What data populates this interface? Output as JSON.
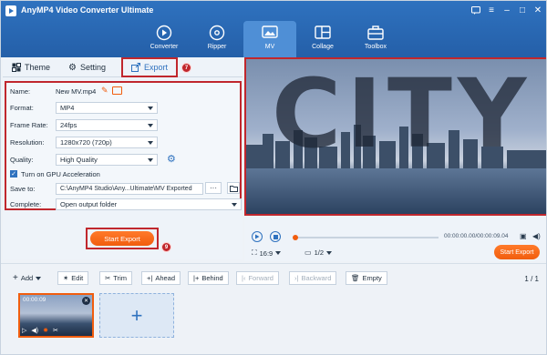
{
  "app": {
    "title": "AnyMP4 Video Converter Ultimate"
  },
  "nav": {
    "items": [
      {
        "label": "Converter",
        "icon": "converter-icon"
      },
      {
        "label": "Ripper",
        "icon": "disc-icon"
      },
      {
        "label": "MV",
        "icon": "mv-icon",
        "active": true
      },
      {
        "label": "Collage",
        "icon": "collage-icon"
      },
      {
        "label": "Toolbox",
        "icon": "toolbox-icon"
      }
    ]
  },
  "tabs": {
    "theme": "Theme",
    "setting": "Setting",
    "export": "Export",
    "export_badge": "7"
  },
  "export": {
    "name_label": "Name:",
    "name_value": "New MV.mp4",
    "format_label": "Format:",
    "format_value": "MP4",
    "frame_rate_label": "Frame Rate:",
    "frame_rate_value": "24fps",
    "resolution_label": "Resolution:",
    "resolution_value": "1280x720 (720p)",
    "quality_label": "Quality:",
    "quality_value": "High Quality",
    "gpu_label": "Turn on GPU Acceleration",
    "save_label": "Save to:",
    "save_value": "C:\\AnyMP4 Studio\\Any...Ultimate\\MV Exported",
    "browse_label": "···",
    "complete_label": "Complete:",
    "complete_value": "Open output folder",
    "settings_badge": "8",
    "start_label": "Start Export",
    "start_badge": "9"
  },
  "player": {
    "timecode": "00:00:00.00/00:00:09.04",
    "ratio": "16:9",
    "page": "1/2",
    "start_label": "Start Export",
    "progress": 0
  },
  "toolbar": {
    "add": "Add",
    "edit": "Edit",
    "trim": "Trim",
    "ahead": "Ahead",
    "behind": "Behind",
    "forward": "Forward",
    "backward": "Backward",
    "empty": "Empty",
    "pager": "1 / 1"
  },
  "timeline": {
    "clip_time": "00:00:09"
  },
  "colors": {
    "accent": "#2f72bf",
    "highlight": "#c0272d",
    "orange": "#f15d0e"
  }
}
